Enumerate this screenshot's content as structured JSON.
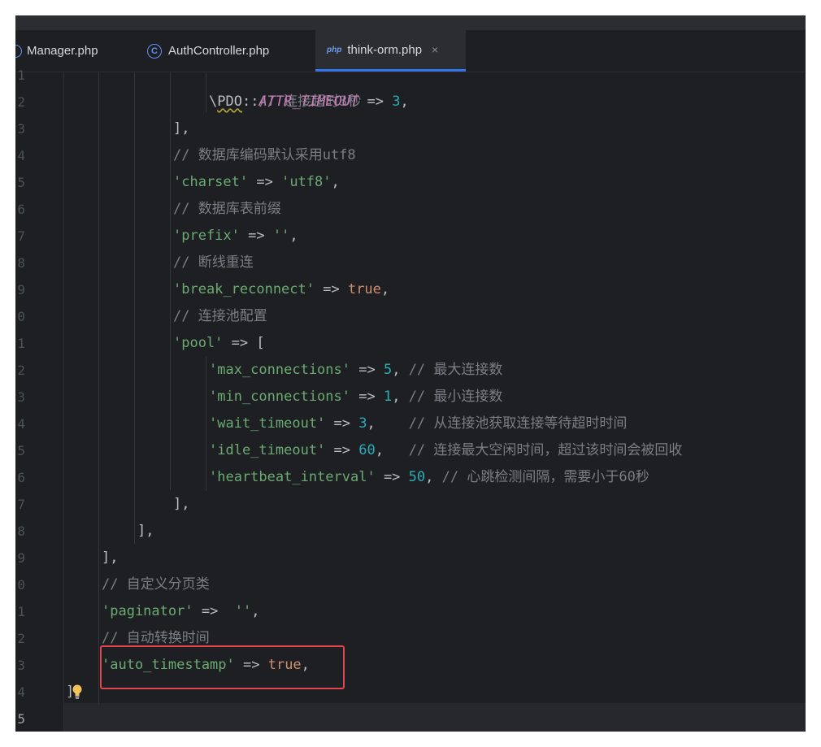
{
  "tabs": [
    {
      "label": "Manager.php",
      "icon": "php-class-icon",
      "active": false
    },
    {
      "label": "AuthController.php",
      "icon": "class-c-icon",
      "active": false
    },
    {
      "label": "think-orm.php",
      "icon": "php-file-icon",
      "active": true,
      "close": "×",
      "icon_text": "php"
    }
  ],
  "line_numbers": [
    "1",
    "2",
    "3",
    "4",
    "5",
    "6",
    "7",
    "8",
    "9",
    "0",
    "1",
    "2",
    "3",
    "4",
    "5",
    "6",
    "7",
    "8",
    "9",
    "0",
    "1",
    "2",
    "3",
    "4",
    "5"
  ],
  "code": {
    "l1_comment": "// 连接超时3秒",
    "l2_backslash": "\\",
    "l2_class": "PDO",
    "l2_sep": "::",
    "l2_const": "ATTR_TIMEOUT",
    "l2_arrow": " => ",
    "l2_num": "3",
    "l2_end": ",",
    "l3": "],",
    "l4_comment": "// 数据库编码默认采用utf8",
    "l5_key": "'charset'",
    "l5_arrow": " => ",
    "l5_val": "'utf8'",
    "l5_end": ",",
    "l6_comment": "// 数据库表前缀",
    "l7_key": "'prefix'",
    "l7_arrow": " => ",
    "l7_val": "''",
    "l7_end": ",",
    "l8_comment": "// 断线重连",
    "l9_key": "'break_reconnect'",
    "l9_arrow": " => ",
    "l9_val": "true",
    "l9_end": ",",
    "l10_comment": "// 连接池配置",
    "l11_key": "'pool'",
    "l11_arrow": " => [",
    "l12_key": "'max_connections'",
    "l12_arrow": " => ",
    "l12_num": "5",
    "l12_end": ", ",
    "l12_comment": "// 最大连接数",
    "l13_key": "'min_connections'",
    "l13_arrow": " => ",
    "l13_num": "1",
    "l13_end": ", ",
    "l13_comment": "// 最小连接数",
    "l14_key": "'wait_timeout'",
    "l14_arrow": " => ",
    "l14_num": "3",
    "l14_end": ",    ",
    "l14_comment": "// 从连接池获取连接等待超时时间",
    "l15_key": "'idle_timeout'",
    "l15_arrow": " => ",
    "l15_num": "60",
    "l15_end": ",   ",
    "l15_comment": "// 连接最大空闲时间，超过该时间会被回收",
    "l16_key": "'heartbeat_interval'",
    "l16_arrow": " => ",
    "l16_num": "50",
    "l16_end": ", ",
    "l16_comment": "// 心跳检测间隔，需要小于60秒",
    "l17": "],",
    "l18": "],",
    "l19": "],",
    "l20_comment": "// 自定义分页类",
    "l21_key": "'paginator'",
    "l21_arrow": " =>  ",
    "l21_val": "''",
    "l21_end": ",",
    "l22_comment": "// 自动转换时间",
    "l23_key": "'auto_timestamp'",
    "l23_arrow": " => ",
    "l23_val": "true",
    "l23_end": ",",
    "l24": "]"
  },
  "colors": {
    "string": "#6aab73",
    "comment": "#7a7e85",
    "number": "#2aacb8",
    "keyword": "#cf8e6d",
    "constant": "#c77dbb",
    "highlight_box": "#e2454f",
    "active_tab_underline": "#3574f0"
  }
}
